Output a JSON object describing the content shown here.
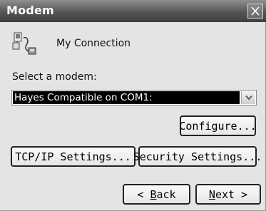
{
  "window": {
    "title": "Modem"
  },
  "connection": {
    "icon": "network-connection-icon",
    "name": "My Connection"
  },
  "modem": {
    "label": "Select a modem:",
    "selected": "Hayes Compatible on COM1:"
  },
  "buttons": {
    "configure": "Configure...",
    "tcpip": "TCP/IP Settings...",
    "security": "Security Settings...",
    "back_prefix": "< ",
    "back_mnemonic": "B",
    "back_rest": "ack",
    "next_mnemonic": "N",
    "next_rest": "ext >"
  },
  "colors": {
    "title_bar": "#555555",
    "selection": "#000000",
    "window_bg": "#e4e4e4"
  }
}
